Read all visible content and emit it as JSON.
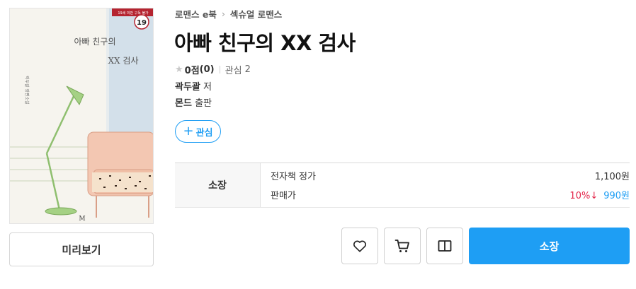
{
  "breadcrumb": {
    "category": "로맨스 e북",
    "separator": "›",
    "subcategory": "섹슈얼 로맨스"
  },
  "book": {
    "title": "아빠 친구의 XX 검사",
    "rating_score": "0점",
    "rating_count": "(0)",
    "wish_label": "관심",
    "wish_count": "2",
    "author": "곽두괄",
    "author_suffix": "저",
    "publisher": "몬드",
    "publisher_suffix": "출판"
  },
  "cover": {
    "age_banner": "19세 미만 구독 불가",
    "age_badge": "19",
    "title_line1": "아빠 친구의",
    "title_line2": "XX 검사",
    "vertical_text": "곽두괄 장편소설",
    "logo": "M"
  },
  "actions": {
    "preview_label": "미리보기",
    "wish_button_plus": "+",
    "wish_button_label": "관심",
    "buy_label": "소장"
  },
  "price": {
    "type_label": "소장",
    "list_price_label": "전자책 정가",
    "list_price": "1,100원",
    "sale_price_label": "판매가",
    "discount": "10%↓",
    "sale_price": "990원"
  },
  "colors": {
    "accent": "#1e9ef4",
    "discount": "#e3264a",
    "badge": "#b52430"
  },
  "icons": [
    "star-icon",
    "plus-icon",
    "heart-icon",
    "cart-icon",
    "book-open-icon"
  ]
}
